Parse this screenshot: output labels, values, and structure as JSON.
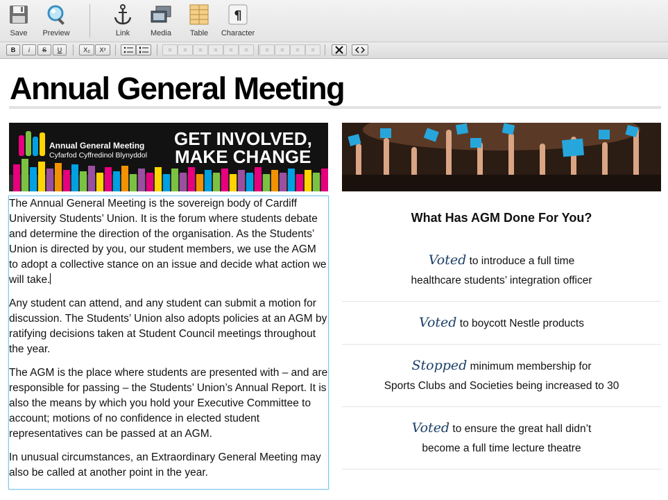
{
  "toolbar": {
    "save": "Save",
    "preview": "Preview",
    "link": "Link",
    "media": "Media",
    "table": "Table",
    "character": "Character"
  },
  "format_bar": {
    "bold": "B",
    "italic": "i",
    "strike": "S",
    "underline": "U",
    "subscript": "X₂",
    "superscript": "X²"
  },
  "page": {
    "title": "Annual General Meeting"
  },
  "banner": {
    "title": "Annual General Meeting",
    "subtitle": "Cyfarfod Cyffredinol Blynyddol",
    "slogan_line1": "GET INVOLVED,",
    "slogan_line2": "MAKE CHANGE"
  },
  "article": {
    "paragraphs": [
      "The Annual General Meeting is the sovereign body of Cardiff University Students’ Union. It is the forum where students debate and determine the direction of the organisation. As the Students’ Union is directed by you, our student members, we use the AGM to adopt a collective stance on an issue and decide what action we will take.",
      "Any student can attend, and any student can submit a motion for discussion. The Students’ Union also adopts policies at an AGM by ratifying decisions taken at Student Council meetings throughout the year.",
      "The AGM is the place where students are presented with – and are responsible for passing – the Students’ Union’s Annual Report. It is also the means by which you hold your Executive Committee to account; motions of no confidence in elected student representatives can be passed at an AGM.",
      "In unusual circumstances, an Extraordinary General Meeting may also be called at another point in the year."
    ]
  },
  "sidebar": {
    "heading": "What Has AGM Done For You?",
    "items": [
      {
        "verb": "Voted",
        "line1": "to introduce a full time",
        "line2": "healthcare students’ integration officer"
      },
      {
        "verb": "Voted",
        "line1": "to boycott Nestle products",
        "line2": ""
      },
      {
        "verb": "Stopped",
        "line1": "minimum membership for",
        "line2": "Sports Clubs and Societies being increased to 30"
      },
      {
        "verb": "Voted",
        "line1": "to ensure the great hall didn’t",
        "line2": "become a full time lecture theatre"
      }
    ]
  },
  "colors": {
    "accent_verb": "#1c3f66",
    "edit_border": "#7ec6ec",
    "banner_bg": "#111111"
  }
}
